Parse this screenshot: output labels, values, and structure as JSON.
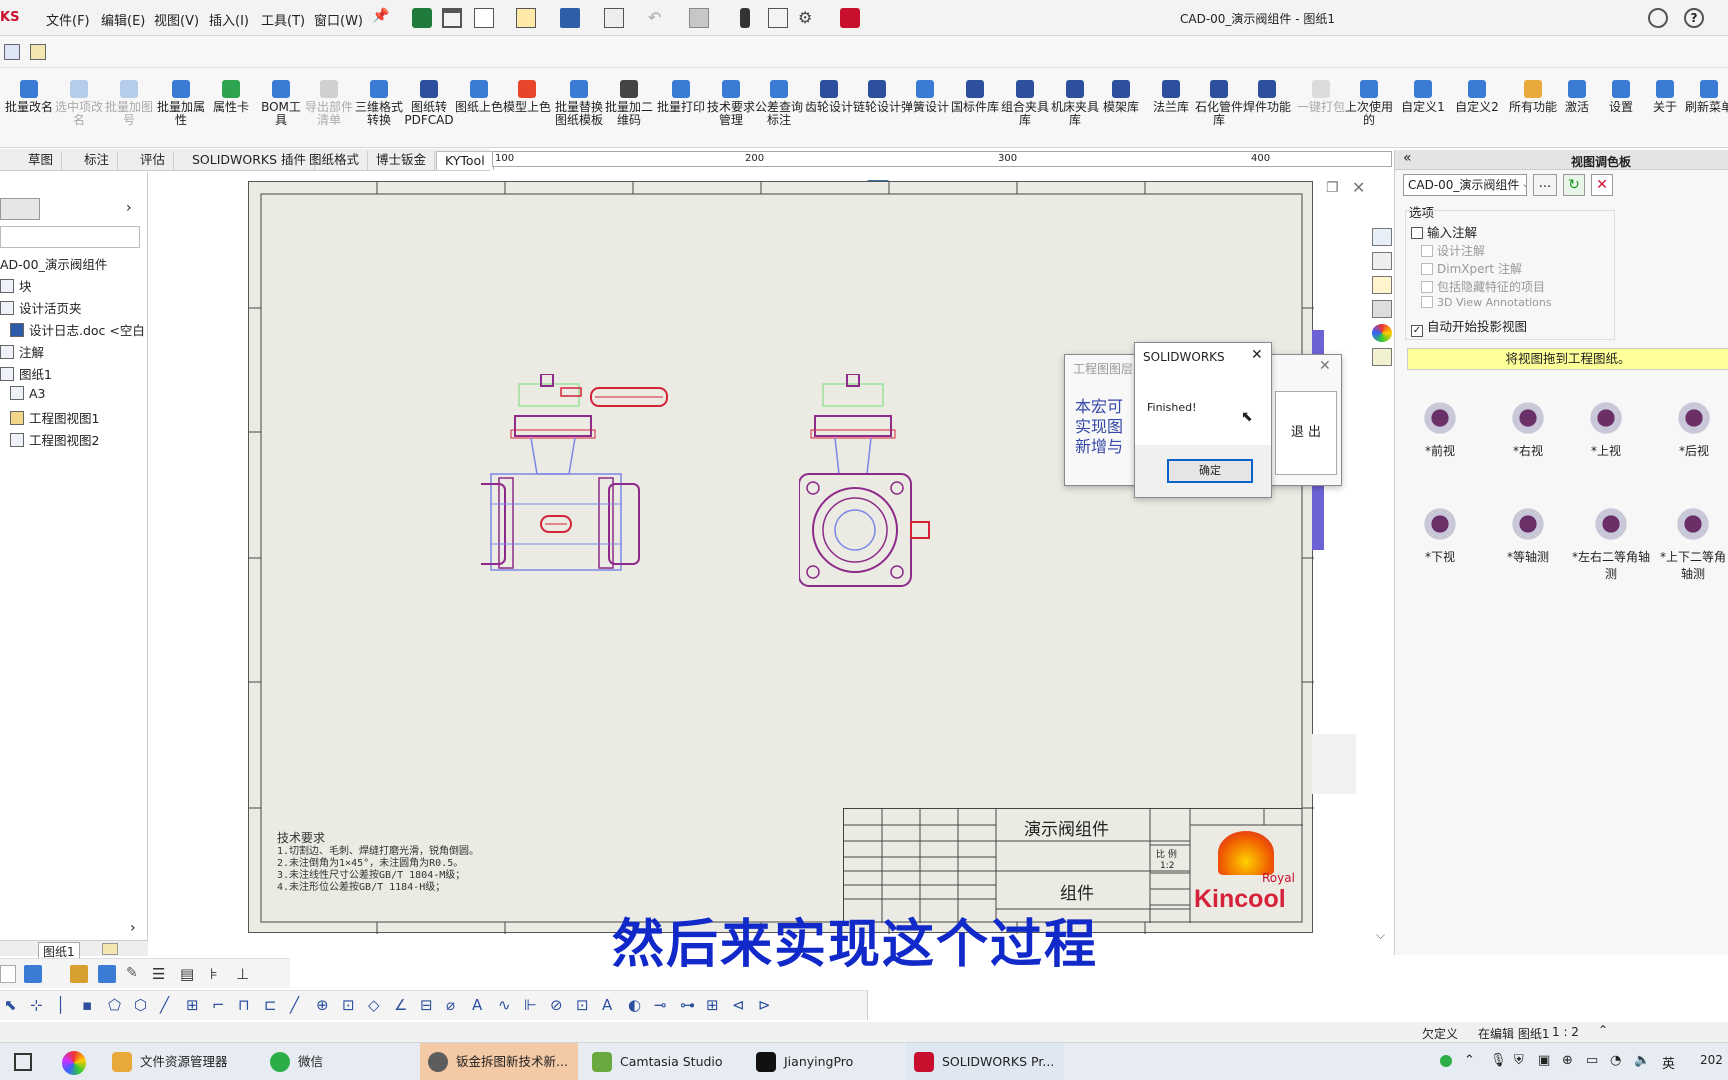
{
  "app": {
    "brand_fragment": "KS",
    "window_title": "CAD-00_演示阀组件 - 图纸1"
  },
  "menu": [
    "文件(F)",
    "编辑(E)",
    "视图(V)",
    "插入(I)",
    "工具(T)",
    "窗口(W)"
  ],
  "commands": [
    {
      "label": "批量改名",
      "enabled": true
    },
    {
      "label": "选中项改名",
      "enabled": false
    },
    {
      "label": "批量加图号",
      "enabled": false
    },
    {
      "label": "批量加属性",
      "enabled": true
    },
    {
      "label": "属性卡",
      "enabled": true
    },
    {
      "label": "BOM工具",
      "enabled": true
    },
    {
      "label": "导出部件清单",
      "enabled": false
    },
    {
      "label": "三维格式转换",
      "enabled": true
    },
    {
      "label": "图纸转PDFCAD",
      "enabled": true
    },
    {
      "label": "图纸上色",
      "enabled": true
    },
    {
      "label": "模型上色",
      "enabled": true
    },
    {
      "label": "批量替换图纸模板",
      "enabled": true
    },
    {
      "label": "批量加二维码",
      "enabled": true
    },
    {
      "label": "批量打印",
      "enabled": true
    },
    {
      "label": "技术要求管理",
      "enabled": true
    },
    {
      "label": "公差查询标注",
      "enabled": true
    },
    {
      "label": "齿轮设计",
      "enabled": true
    },
    {
      "label": "链轮设计",
      "enabled": true
    },
    {
      "label": "弹簧设计",
      "enabled": true
    },
    {
      "label": "国标件库",
      "enabled": true
    },
    {
      "label": "组合夹具库",
      "enabled": true
    },
    {
      "label": "机床夹具库",
      "enabled": true
    },
    {
      "label": "模架库",
      "enabled": true
    },
    {
      "label": "法兰库",
      "enabled": true
    },
    {
      "label": "石化管件库",
      "enabled": true
    },
    {
      "label": "焊件功能",
      "enabled": true
    },
    {
      "label": "一键打包",
      "enabled": false
    },
    {
      "label": "上次使用的",
      "enabled": true
    },
    {
      "label": "自定义1",
      "enabled": true
    },
    {
      "label": "自定义2",
      "enabled": true
    },
    {
      "label": "所有功能",
      "enabled": true
    },
    {
      "label": "激活",
      "enabled": true
    },
    {
      "label": "设置",
      "enabled": true
    },
    {
      "label": "关于",
      "enabled": true
    },
    {
      "label": "刷新菜单",
      "enabled": true
    }
  ],
  "tabs": [
    "草图",
    "标注",
    "评估",
    "SOLIDWORKS 插件",
    "图纸格式",
    "博士钣金",
    "KYTool"
  ],
  "active_tab": "KYTool",
  "ruler": [
    "100",
    "200",
    "300",
    "400"
  ],
  "tree": {
    "root": "AD-00_演示阀组件",
    "items": [
      "块",
      "设计活页夹",
      "设计日志.doc <空白",
      "注解",
      "图纸1",
      "A3",
      "工程图视图1",
      "工程图视图2"
    ]
  },
  "sheet_tab": "图纸1",
  "titleblock": {
    "assembly_name": "演示阀组件",
    "part_name": "组件",
    "scale_label": "比 例",
    "scale_value": "1:2",
    "logo_royal": "Royal",
    "logo_kincool": "Kincool",
    "tech_title": "技术要求",
    "tech_lines": [
      "1.切割边、毛刺、焊缝打磨光滑，锐角倒圆。",
      "2.未注倒角为1×45°，未注圆角为R0.5。",
      "3.未注线性尺寸公差按GB/T 1804-M级；",
      "4.未注形位公差按GB/T 1184-H级；"
    ]
  },
  "dialog_back": {
    "title": "工程图图层",
    "text": "本宏可实现图新增与",
    "exit_button": "退 出"
  },
  "dialog_msg": {
    "title": "SOLIDWORKS",
    "message": "Finished!",
    "ok_button": "确定"
  },
  "palette": {
    "title": "视图调色板",
    "document": "CAD-00_演示阀组件",
    "options_label": "选项",
    "options": [
      {
        "label": "输入注解",
        "checked": false,
        "enabled": true
      },
      {
        "label": "设计注解",
        "checked": false,
        "enabled": false
      },
      {
        "label": "DimXpert 注解",
        "checked": false,
        "enabled": false
      },
      {
        "label": "包括隐藏特征的项目",
        "checked": false,
        "enabled": false
      },
      {
        "label": "3D View Annotations",
        "checked": false,
        "enabled": false
      },
      {
        "label": "自动开始投影视图",
        "checked": true,
        "enabled": true
      }
    ],
    "drag_hint": "将视图拖到工程图纸。",
    "views": [
      "*前视",
      "*右视",
      "*上视",
      "*后视",
      "*下视",
      "*等轴测",
      "*左右二等角轴测",
      "*上下二等角轴测"
    ]
  },
  "subtitle": "然后来实现这个过程",
  "status": {
    "state": "欠定义",
    "editing": "在编辑 图纸1",
    "scale": "1 : 2"
  },
  "taskbar": [
    {
      "label": "文件资源管理器",
      "color": "#e8a93a"
    },
    {
      "label": "微信",
      "color": "#2bae48"
    },
    {
      "label": "钣金拆图新技术新...",
      "color": "#c9752b"
    },
    {
      "label": "Camtasia Studio -...",
      "color": "#6aa840"
    },
    {
      "label": "JianyingPro",
      "color": "#111111"
    },
    {
      "label": "SOLIDWORKS Pr...",
      "color": "#c8102e"
    }
  ],
  "tray": {
    "lang": "英",
    "clock": "202"
  },
  "colors": {
    "drawing_magenta": "#8e2a8a",
    "drawing_blue": "#7d87e6",
    "drawing_red": "#d6213a",
    "subtitle_blue": "#1029c8",
    "highlight_yellow": "#ffff99"
  }
}
